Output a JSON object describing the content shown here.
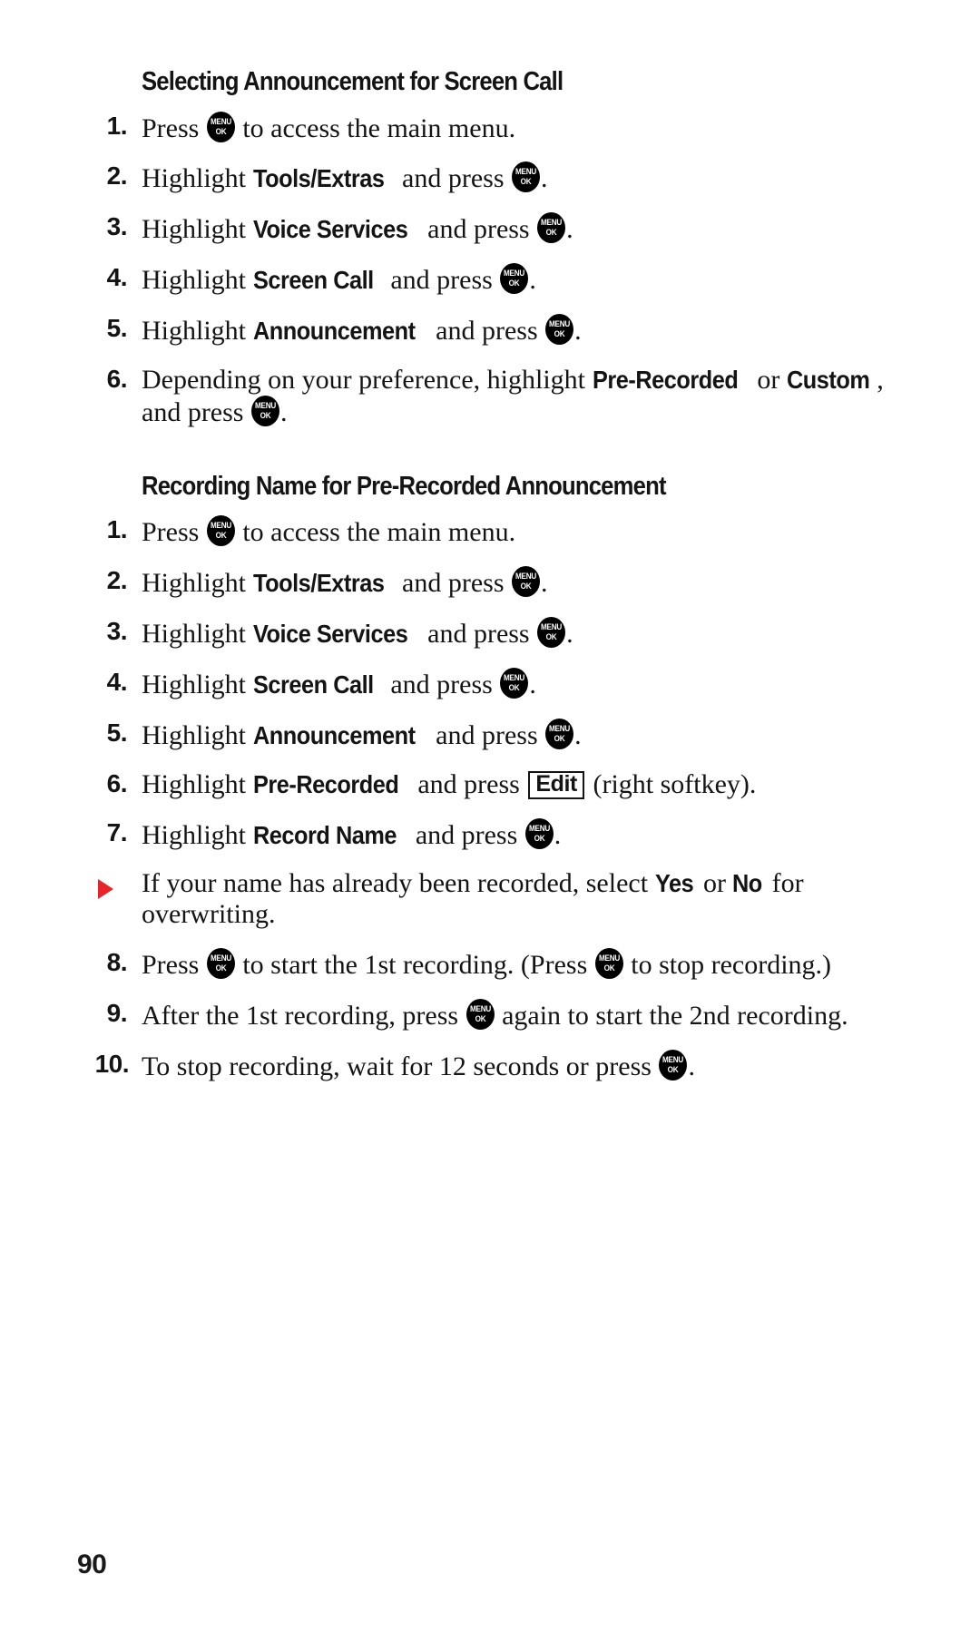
{
  "document": {
    "page_number": "90",
    "accent_color": "#E8232A",
    "text_color": "#141414"
  },
  "icons": {
    "menu_ok_key": {
      "line1": "MENU",
      "line2": "OK",
      "name": "menu-ok-key-icon"
    },
    "bullet_triangle": {
      "name": "red-triangle-bullet-icon"
    }
  },
  "sections": [
    {
      "heading": "Selecting Announcement for Screen Call",
      "steps": [
        {
          "num": "1.",
          "parts": [
            {
              "t": "text",
              "v": "Press "
            },
            {
              "t": "key"
            },
            {
              "t": "text",
              "v": " to access the main menu."
            }
          ]
        },
        {
          "num": "2.",
          "parts": [
            {
              "t": "text",
              "v": "Highlight "
            },
            {
              "t": "term",
              "v": "Tools/Extras"
            },
            {
              "t": "text",
              "v": " and press "
            },
            {
              "t": "key"
            },
            {
              "t": "text",
              "v": "."
            }
          ]
        },
        {
          "num": "3.",
          "parts": [
            {
              "t": "text",
              "v": "Highlight "
            },
            {
              "t": "term",
              "v": "Voice Services"
            },
            {
              "t": "text",
              "v": " and press "
            },
            {
              "t": "key"
            },
            {
              "t": "text",
              "v": "."
            }
          ]
        },
        {
          "num": "4.",
          "parts": [
            {
              "t": "text",
              "v": "Highlight "
            },
            {
              "t": "term",
              "v": "Screen Call"
            },
            {
              "t": "text",
              "v": " and press "
            },
            {
              "t": "key"
            },
            {
              "t": "text",
              "v": "."
            }
          ]
        },
        {
          "num": "5.",
          "parts": [
            {
              "t": "text",
              "v": "Highlight "
            },
            {
              "t": "term",
              "v": "Announcement"
            },
            {
              "t": "text",
              "v": " and press "
            },
            {
              "t": "key"
            },
            {
              "t": "text",
              "v": "."
            }
          ]
        },
        {
          "num": "6.",
          "parts": [
            {
              "t": "text",
              "v": "Depending on your preference, highlight "
            },
            {
              "t": "term",
              "v": "Pre-Recorded"
            },
            {
              "t": "text",
              "v": " or "
            },
            {
              "t": "term",
              "v": "Custom"
            },
            {
              "t": "text",
              "v": ", and press "
            },
            {
              "t": "key"
            },
            {
              "t": "text",
              "v": "."
            }
          ]
        }
      ]
    },
    {
      "heading": "Recording Name for Pre-Recorded Announcement",
      "steps": [
        {
          "num": "1.",
          "parts": [
            {
              "t": "text",
              "v": "Press "
            },
            {
              "t": "key"
            },
            {
              "t": "text",
              "v": " to access the main menu."
            }
          ]
        },
        {
          "num": "2.",
          "parts": [
            {
              "t": "text",
              "v": "Highlight "
            },
            {
              "t": "term",
              "v": "Tools/Extras"
            },
            {
              "t": "text",
              "v": " and press "
            },
            {
              "t": "key"
            },
            {
              "t": "text",
              "v": "."
            }
          ]
        },
        {
          "num": "3.",
          "parts": [
            {
              "t": "text",
              "v": "Highlight "
            },
            {
              "t": "term",
              "v": "Voice Services"
            },
            {
              "t": "text",
              "v": " and press "
            },
            {
              "t": "key"
            },
            {
              "t": "text",
              "v": "."
            }
          ]
        },
        {
          "num": "4.",
          "parts": [
            {
              "t": "text",
              "v": "Highlight "
            },
            {
              "t": "term",
              "v": "Screen Call"
            },
            {
              "t": "text",
              "v": " and press "
            },
            {
              "t": "key"
            },
            {
              "t": "text",
              "v": "."
            }
          ]
        },
        {
          "num": "5.",
          "parts": [
            {
              "t": "text",
              "v": "Highlight "
            },
            {
              "t": "term",
              "v": "Announcement"
            },
            {
              "t": "text",
              "v": " and press "
            },
            {
              "t": "key"
            },
            {
              "t": "text",
              "v": "."
            }
          ]
        },
        {
          "num": "6.",
          "parts": [
            {
              "t": "text",
              "v": "Highlight "
            },
            {
              "t": "term",
              "v": "Pre-Recorded"
            },
            {
              "t": "text",
              "v": " and press "
            },
            {
              "t": "softkey",
              "v": "Edit"
            },
            {
              "t": "text",
              "v": " (right softkey)."
            }
          ]
        },
        {
          "num": "7.",
          "parts": [
            {
              "t": "text",
              "v": "Highlight "
            },
            {
              "t": "term",
              "v": "Record Name"
            },
            {
              "t": "text",
              "v": " and press "
            },
            {
              "t": "key"
            },
            {
              "t": "text",
              "v": "."
            }
          ]
        },
        {
          "num": "▶",
          "bullet": true,
          "parts": [
            {
              "t": "text",
              "v": "If your name has already been recorded, select "
            },
            {
              "t": "term",
              "v": "Yes"
            },
            {
              "t": "text",
              "v": " or "
            },
            {
              "t": "term",
              "v": "No"
            },
            {
              "t": "text",
              "v": " for overwriting."
            }
          ]
        },
        {
          "num": "8.",
          "parts": [
            {
              "t": "text",
              "v": "Press "
            },
            {
              "t": "key"
            },
            {
              "t": "text",
              "v": " to start the 1st recording. (Press "
            },
            {
              "t": "key"
            },
            {
              "t": "text",
              "v": " to stop recording.)"
            }
          ]
        },
        {
          "num": "9.",
          "parts": [
            {
              "t": "text",
              "v": "After the 1st recording, press "
            },
            {
              "t": "key"
            },
            {
              "t": "text",
              "v": " again to start the 2nd recording."
            }
          ]
        },
        {
          "num": "10.",
          "parts": [
            {
              "t": "text",
              "v": "To stop recording, wait for 12 seconds or press "
            },
            {
              "t": "key"
            },
            {
              "t": "text",
              "v": "."
            }
          ]
        }
      ]
    }
  ]
}
